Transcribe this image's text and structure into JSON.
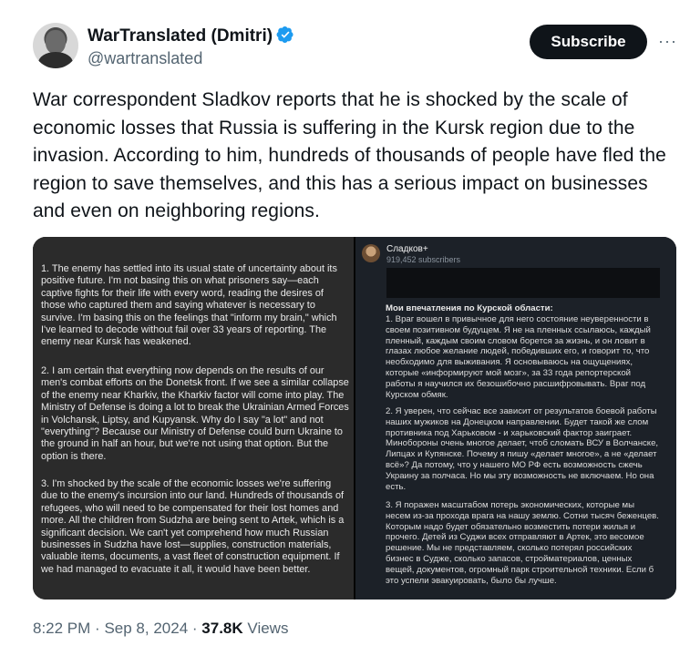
{
  "author": {
    "name": "WarTranslated (Dmitri)",
    "handle": "@wartranslated",
    "avatar_icon": "profile-photo",
    "verified_icon": "verified-badge-icon",
    "verified_color": "#1d9bf0"
  },
  "actions": {
    "subscribe_label": "Subscribe",
    "more_label": "···"
  },
  "tweet": {
    "text": "War correspondent Sladkov reports that he is shocked by the scale of economic losses that Russia is suffering in the Kursk region due to the invasion. According to him, hundreds of thousands of people have fled the region to save themselves, and this has a serious impact on businesses and even on neighboring regions."
  },
  "media_left": {
    "paragraphs": [
      "1. The enemy has settled into its usual state of uncertainty about its positive future. I'm not basing this on what prisoners say—each captive fights for their life with every word, reading the desires of those who captured them and saying whatever is necessary to survive. I'm basing this on the feelings that \"inform my brain,\" which I've learned to decode without fail over 33 years of reporting. The enemy near Kursk has weakened.",
      "2. I am certain that everything now depends on the results of our men's combat efforts on the Donetsk front. If we see a similar collapse of the enemy near Kharkiv, the Kharkiv factor will come into play. The Ministry of Defense is doing a lot to break the Ukrainian Armed Forces in Volchansk, Liptsy, and Kupyansk. Why do I say \"a lot\" and not \"everything\"? Because our Ministry of Defense could burn Ukraine to the ground in half an hour, but we're not using that option. But the option is there.",
      "3. I'm shocked by the scale of the economic losses we're suffering due to the enemy's incursion into our land. Hundreds of thousands of refugees, who will need to be compensated for their lost homes and more. All the children from Sudzha are being sent to Artek, which is a significant decision. We can't yet comprehend how much Russian businesses in Sudzha have lost—supplies, construction materials, valuable items, documents, a vast fleet of construction equipment. If we had managed to evacuate it all, it would have been better."
    ]
  },
  "media_right": {
    "channel_name": "Сладков+",
    "subscribers": "919,452 subscribers",
    "heading": "Мои впечатления по Курской области:",
    "paragraphs": [
      "1. Враг вошел в привычное для него состояние неуверенности в своем позитивном будущем. Я не на пленных ссылаюсь, каждый пленный, каждым своим словом борется за жизнь, и он ловит в глазах любое желание людей, победивших его, и говорит то, что необходимо для выживания. Я основываюсь на ощущениях, которые «информируют мой мозг», за 33 года репортерской работы я научился их безошибочно расшифровывать. Враг под Курском обмяк.",
      "2. Я уверен, что сейчас все зависит от результатов боевой работы наших мужиков на Донецком направлении. Будет такой же слом противника под Харьковом - и харьковский фактор заиграет. Минобороны очень многое делает, чтоб сломать ВСУ в Волчанске, Липцах и Купянске. Почему я пишу «делает многое», а не «делает всё»? Да потому, что у нашего МО РФ есть возможность сжечь Украину за полчаса. Но мы эту возможность не включаем. Но она есть.",
      "3. Я поражен масштабом потерь экономических, которые мы несем из-за прохода врага на нашу землю. Сотни тысяч беженцев. Которым надо будет обязательно возместить потери жилья и прочего. Детей из Суджи всех отправляют в Артек, это весомое решение. Мы не представляем, сколько потерял российских бизнес в Судже, сколько запасов, стройматериалов, ценных вещей, документов, огромный парк строительной техники. Если б это успели эвакуировать, было бы лучше."
    ]
  },
  "footer": {
    "time": "8:22 PM",
    "separator": "·",
    "date": "Sep 8, 2024",
    "views_count": "37.8K",
    "views_label": "Views"
  }
}
